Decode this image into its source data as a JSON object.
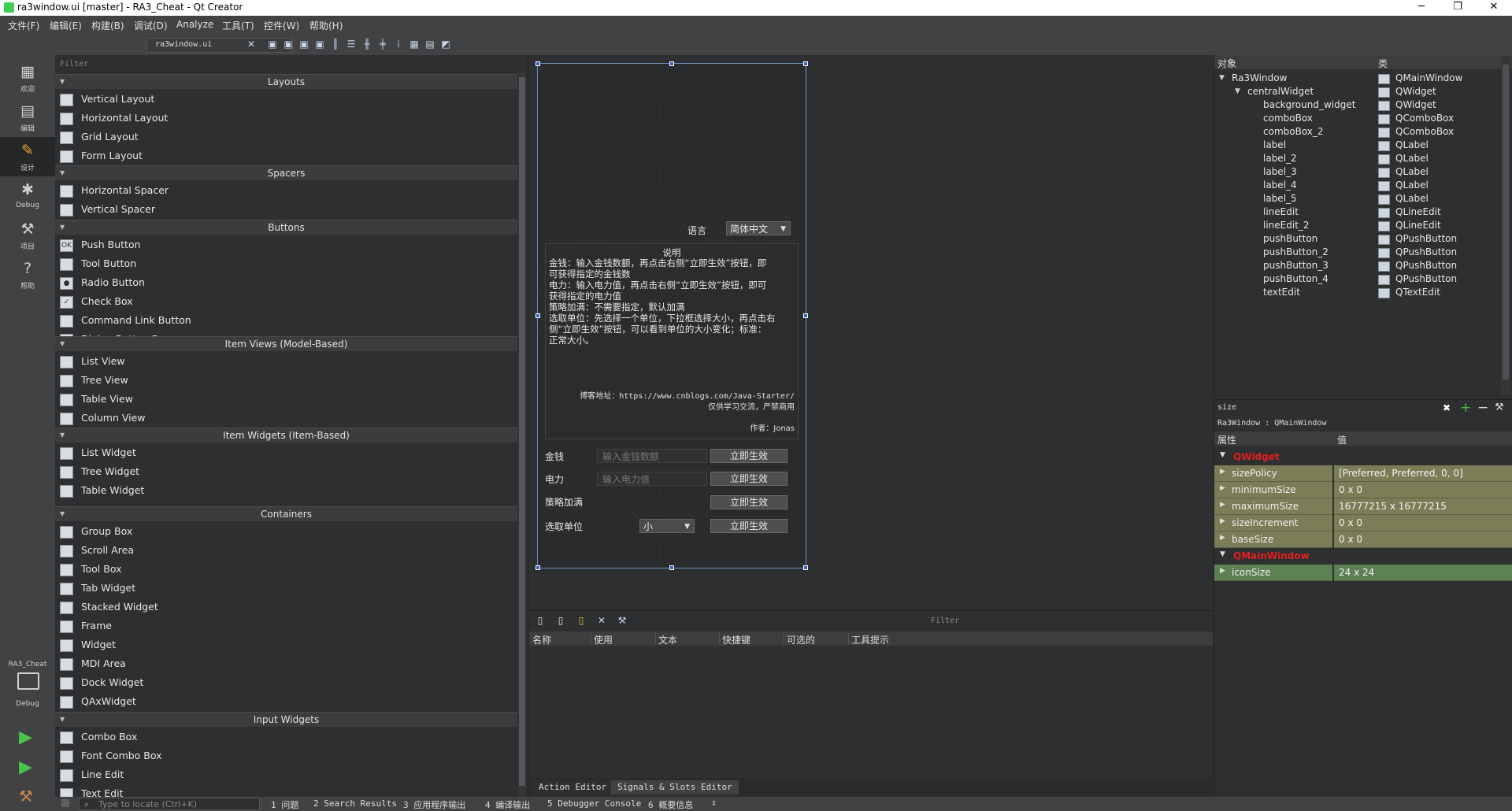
{
  "window": {
    "title": "ra3window.ui [master] - RA3_Cheat - Qt Creator",
    "min_glyph": "─",
    "max_glyph": "❐",
    "close_glyph": "✕"
  },
  "menu": [
    "文件(F)",
    "编辑(E)",
    "构建(B)",
    "调试(D)",
    "Analyze",
    "工具(T)",
    "控件(W)",
    "帮助(H)"
  ],
  "modes": [
    {
      "label": "欢迎",
      "icon": "grid-icon"
    },
    {
      "label": "编辑",
      "icon": "document-icon"
    },
    {
      "label": "设计",
      "icon": "pencil-icon"
    },
    {
      "label": "Debug",
      "icon": "bug-icon"
    },
    {
      "label": "项目",
      "icon": "wrench-icon"
    },
    {
      "label": "帮助",
      "icon": "help-icon"
    }
  ],
  "kit": {
    "project": "RA3_Cheat",
    "config": "Debug"
  },
  "toolbar": {
    "file": "ra3window.ui"
  },
  "widgetbox": {
    "filter_placeholder": "Filter",
    "categories": [
      {
        "name": "Layouts",
        "items": [
          "Vertical Layout",
          "Horizontal Layout",
          "Grid Layout",
          "Form Layout"
        ]
      },
      {
        "name": "Spacers",
        "items": [
          "Horizontal Spacer",
          "Vertical Spacer"
        ]
      },
      {
        "name": "Buttons",
        "items": [
          "Push Button",
          "Tool Button",
          "Radio Button",
          "Check Box",
          "Command Link Button",
          "Dialog Button Box"
        ]
      },
      {
        "name": "Item Views (Model-Based)",
        "items": [
          "List View",
          "Tree View",
          "Table View",
          "Column View"
        ]
      },
      {
        "name": "Item Widgets (Item-Based)",
        "items": [
          "List Widget",
          "Tree Widget",
          "Table Widget"
        ]
      },
      {
        "name": "Containers",
        "items": [
          "Group Box",
          "Scroll Area",
          "Tool Box",
          "Tab Widget",
          "Stacked Widget",
          "Frame",
          "Widget",
          "MDI Area",
          "Dock Widget",
          "QAxWidget"
        ]
      },
      {
        "name": "Input Widgets",
        "items": [
          "Combo Box",
          "Font Combo Box",
          "Line Edit",
          "Text Edit"
        ]
      }
    ]
  },
  "form": {
    "language_label": "语言",
    "language_value": "简体中文",
    "text_title": "说明",
    "text_lines": [
      "金钱：输入金钱数额，再点击右侧“立即生效”按钮，即",
      "可获得指定的金钱数",
      "电力：输入电力值，再点击右侧“立即生效”按钮，即可",
      "获得指定的电力值",
      "策略加满：不需要指定，默认加满",
      "选取单位：先选择一个单位，下拉框选择大小，再点击右",
      "侧“立即生效”按钮，可以看到单位的大小变化；标准：",
      "正常大小。"
    ],
    "blog_line": "博客地址：https://www.cnblogs.com/Java-Starter/",
    "notice_line": "仅供学习交流，严禁商用",
    "author_line": "作者：Jonas",
    "rows": [
      {
        "label": "金钱",
        "placeholder": "输入金钱数额",
        "button": "立即生效"
      },
      {
        "label": "电力",
        "placeholder": "输入电力值",
        "button": "立即生效"
      },
      {
        "label": "策略加满",
        "button": "立即生效"
      },
      {
        "label": "选取单位",
        "combo": "小",
        "button": "立即生效"
      }
    ]
  },
  "action_editor": {
    "filter_placeholder": "Filter",
    "columns": [
      "名称",
      "使用",
      "文本",
      "快捷键",
      "可选的",
      "工具提示"
    ],
    "tabs": [
      "Action Editor",
      "Signals & Slots Editor"
    ]
  },
  "object_inspector": {
    "col_object": "对象",
    "col_class": "类",
    "rows": [
      {
        "name": "Ra3Window",
        "cls": "QMainWindow",
        "depth": 0,
        "arrow": "▼"
      },
      {
        "name": "centralWidget",
        "cls": "QWidget",
        "depth": 1,
        "arrow": "▼"
      },
      {
        "name": "background_widget",
        "cls": "QWidget",
        "depth": 2,
        "arrow": ""
      },
      {
        "name": "comboBox",
        "cls": "QComboBox",
        "depth": 2,
        "arrow": ""
      },
      {
        "name": "comboBox_2",
        "cls": "QComboBox",
        "depth": 2,
        "arrow": ""
      },
      {
        "name": "label",
        "cls": "QLabel",
        "depth": 2,
        "arrow": ""
      },
      {
        "name": "label_2",
        "cls": "QLabel",
        "depth": 2,
        "arrow": ""
      },
      {
        "name": "label_3",
        "cls": "QLabel",
        "depth": 2,
        "arrow": ""
      },
      {
        "name": "label_4",
        "cls": "QLabel",
        "depth": 2,
        "arrow": ""
      },
      {
        "name": "label_5",
        "cls": "QLabel",
        "depth": 2,
        "arrow": ""
      },
      {
        "name": "lineEdit",
        "cls": "QLineEdit",
        "depth": 2,
        "arrow": ""
      },
      {
        "name": "lineEdit_2",
        "cls": "QLineEdit",
        "depth": 2,
        "arrow": ""
      },
      {
        "name": "pushButton",
        "cls": "QPushButton",
        "depth": 2,
        "arrow": ""
      },
      {
        "name": "pushButton_2",
        "cls": "QPushButton",
        "depth": 2,
        "arrow": ""
      },
      {
        "name": "pushButton_3",
        "cls": "QPushButton",
        "depth": 2,
        "arrow": ""
      },
      {
        "name": "pushButton_4",
        "cls": "QPushButton",
        "depth": 2,
        "arrow": ""
      },
      {
        "name": "textEdit",
        "cls": "QTextEdit",
        "depth": 2,
        "arrow": ""
      }
    ]
  },
  "property_editor": {
    "filter_value": "size",
    "class_line": "Ra3Window : QMainWindow",
    "col_property": "属性",
    "col_value": "值",
    "section_widget": "QWidget",
    "section_mainwindow": "QMainWindow",
    "widget_props": [
      {
        "name": "sizePolicy",
        "value": "[Preferred, Preferred, 0, 0]"
      },
      {
        "name": "minimumSize",
        "value": "0 x 0"
      },
      {
        "name": "maximumSize",
        "value": "16777215 x 16777215"
      },
      {
        "name": "sizeIncrement",
        "value": "0 x 0"
      },
      {
        "name": "baseSize",
        "value": "0 x 0"
      }
    ],
    "mainwindow_props": [
      {
        "name": "iconSize",
        "value": "24 x 24"
      }
    ]
  },
  "statusbar": {
    "locate_placeholder": "Type to locate (Ctrl+K)",
    "panes": [
      "1 问题",
      "2 Search Results",
      "3 应用程序输出",
      "4 编译输出",
      "5 Debugger Console",
      "6 概要信息"
    ]
  },
  "colors": {
    "accent_red": "#e21f1f",
    "property_bg": "#7b7d57",
    "selection_blue": "#2f64c8"
  }
}
